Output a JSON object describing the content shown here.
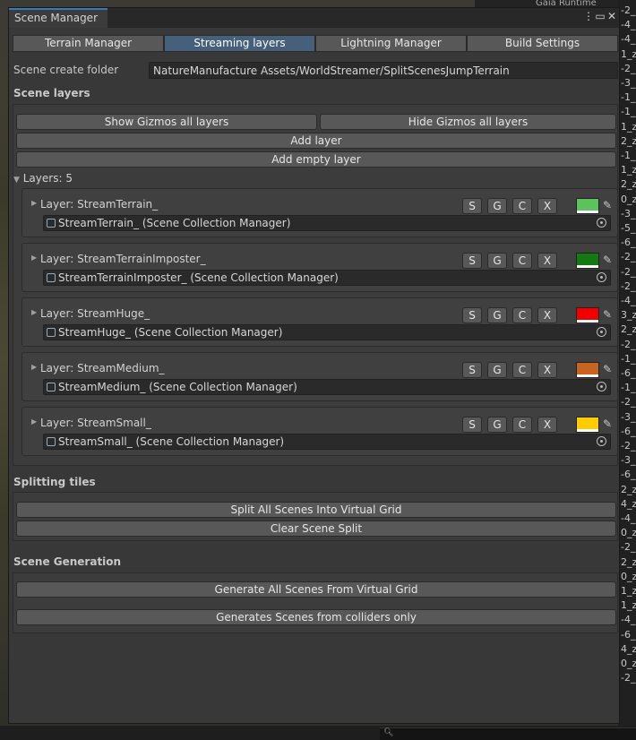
{
  "window": {
    "tab_title": "Scene Manager"
  },
  "toolbar": {
    "tabs": [
      {
        "label": "Terrain Manager",
        "active": false
      },
      {
        "label": "Streaming layers",
        "active": true
      },
      {
        "label": "Lightning Manager",
        "active": false
      },
      {
        "label": "Build Settings",
        "active": false
      }
    ]
  },
  "scene_folder": {
    "label": "Scene create folder",
    "value": "NatureManufacture Assets/WorldStreamer/SplitScenesJumpTerrain"
  },
  "scene_layers": {
    "title": "Scene layers",
    "show_gizmos_label": "Show Gizmos all layers",
    "hide_gizmos_label": "Hide Gizmos all layers",
    "add_layer_label": "Add layer",
    "add_empty_layer_label": "Add empty layer",
    "layers_count_label": "Layers: 5",
    "button_labels": {
      "s": "S",
      "g": "G",
      "c": "C",
      "x": "X"
    },
    "layers": [
      {
        "name": "Layer: StreamTerrain_",
        "object": "StreamTerrain_ (Scene Collection Manager)",
        "color": "#5cc25c"
      },
      {
        "name": "Layer: StreamTerrainImposter_",
        "object": "StreamTerrainImposter_ (Scene Collection Manager)",
        "color": "#137a13"
      },
      {
        "name": "Layer: StreamHuge_",
        "object": "StreamHuge_ (Scene Collection Manager)",
        "color": "#f00000"
      },
      {
        "name": "Layer: StreamMedium_",
        "object": "StreamMedium_ (Scene Collection Manager)",
        "color": "#c8641e"
      },
      {
        "name": "Layer: StreamSmall_",
        "object": "StreamSmall_ (Scene Collection Manager)",
        "color": "#ffcc00"
      }
    ]
  },
  "splitting": {
    "title": "Splitting tiles",
    "split_label": "Split All Scenes Into Virtual Grid",
    "clear_label": "Clear Scene Split"
  },
  "generation": {
    "title": "Scene Generation",
    "grid_label": "Generate All Scenes From Virtual Grid",
    "colliders_label": "Generates Scenes from colliders only"
  },
  "background_right_items": [
    "-2_",
    "-4_",
    "-4_",
    "1_z",
    "-2_",
    "-3_",
    "-1_",
    "-1_",
    "1_z",
    "2_z",
    "-1_",
    "1_z",
    "2_z",
    "0_z",
    "-3_",
    "-5_",
    "-6_",
    "-2_",
    "-2_",
    "-2_",
    "-4_",
    "3_z",
    "2_z",
    "-2_",
    "-1_",
    "-6_",
    "-1_",
    "-2_",
    "-3_",
    "-6_",
    "-2_",
    "-3_",
    "-6_",
    "2_z",
    "4_z",
    "-4_",
    "0_z",
    "-2_",
    "2_z",
    "0_z",
    "1_z",
    "1_z",
    "-4_",
    "-6_",
    "4_z",
    "0_z",
    "-2_"
  ],
  "background_top_text": "Gaia Runtime",
  "icons": {
    "menu": "kebab-menu-icon",
    "maximize": "maximize-icon",
    "close": "close-icon",
    "picker": "eyedropper-icon",
    "object": "scene-object-icon",
    "target": "object-picker-icon"
  }
}
